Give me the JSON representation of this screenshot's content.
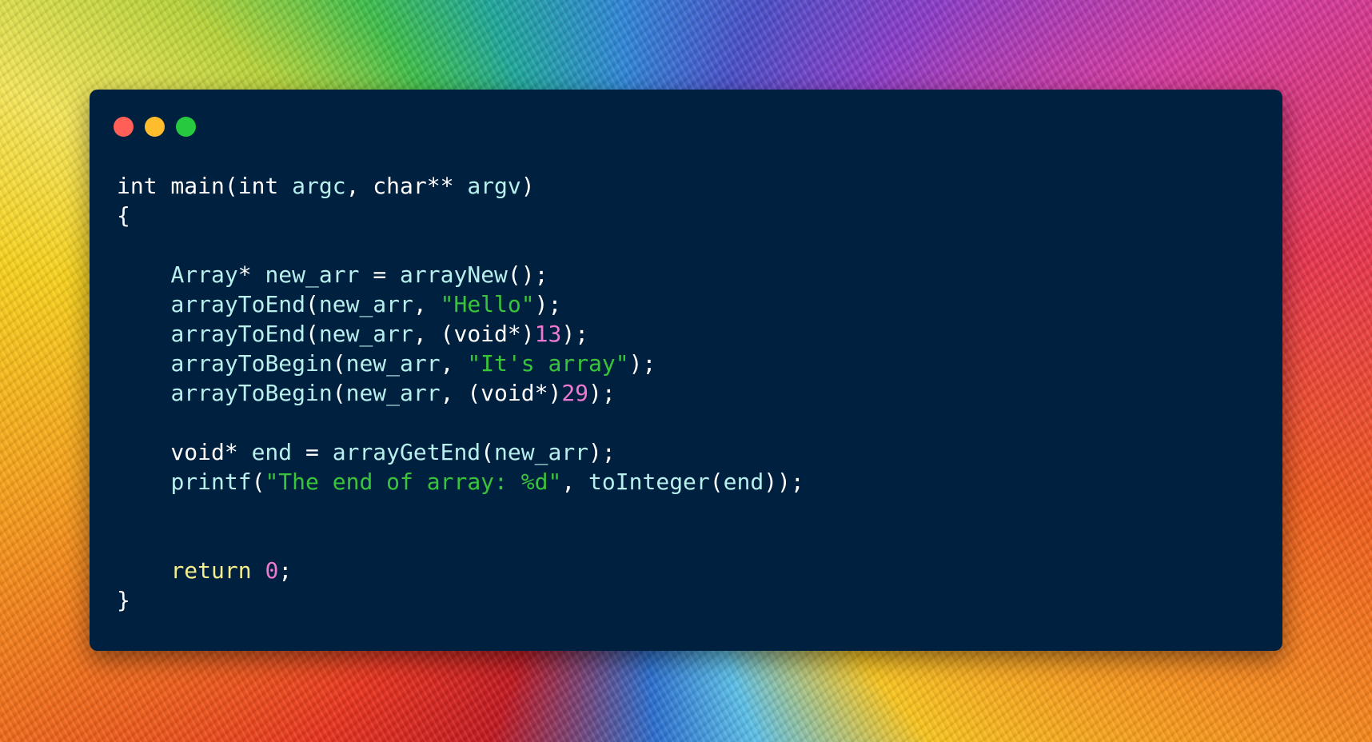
{
  "window": {
    "controls": [
      "close",
      "minimize",
      "maximize"
    ],
    "colors": {
      "background": "#00203f",
      "close": "#ff5f56",
      "minimize": "#ffbd2e",
      "maximize": "#27c93f"
    }
  },
  "code": {
    "colors": {
      "plain": "#ffffff",
      "identifier": "#b8f0ee",
      "keyword": "#f4ee8e",
      "string": "#39c53b",
      "number": "#ee79d1"
    },
    "lines": [
      [
        [
          "pl",
          "int main(int "
        ],
        [
          "fn",
          "argc"
        ],
        [
          "pl",
          ", char** "
        ],
        [
          "fn",
          "argv"
        ],
        [
          "pl",
          ")"
        ]
      ],
      [
        [
          "pl",
          "{"
        ]
      ],
      [],
      [
        [
          "pl",
          "    "
        ],
        [
          "fn",
          "Array"
        ],
        [
          "pl",
          "* "
        ],
        [
          "fn",
          "new_arr"
        ],
        [
          "pl",
          " = "
        ],
        [
          "fn",
          "arrayNew"
        ],
        [
          "pl",
          "();"
        ]
      ],
      [
        [
          "pl",
          "    "
        ],
        [
          "fn",
          "arrayToEnd"
        ],
        [
          "pl",
          "("
        ],
        [
          "fn",
          "new_arr"
        ],
        [
          "pl",
          ", "
        ],
        [
          "str",
          "\"Hello\""
        ],
        [
          "pl",
          ");"
        ]
      ],
      [
        [
          "pl",
          "    "
        ],
        [
          "fn",
          "arrayToEnd"
        ],
        [
          "pl",
          "("
        ],
        [
          "fn",
          "new_arr"
        ],
        [
          "pl",
          ", (void*)"
        ],
        [
          "num",
          "13"
        ],
        [
          "pl",
          ");"
        ]
      ],
      [
        [
          "pl",
          "    "
        ],
        [
          "fn",
          "arrayToBegin"
        ],
        [
          "pl",
          "("
        ],
        [
          "fn",
          "new_arr"
        ],
        [
          "pl",
          ", "
        ],
        [
          "str",
          "\"It's array\""
        ],
        [
          "pl",
          ");"
        ]
      ],
      [
        [
          "pl",
          "    "
        ],
        [
          "fn",
          "arrayToBegin"
        ],
        [
          "pl",
          "("
        ],
        [
          "fn",
          "new_arr"
        ],
        [
          "pl",
          ", (void*)"
        ],
        [
          "num",
          "29"
        ],
        [
          "pl",
          ");"
        ]
      ],
      [],
      [
        [
          "pl",
          "    void* "
        ],
        [
          "fn",
          "end"
        ],
        [
          "pl",
          " = "
        ],
        [
          "fn",
          "arrayGetEnd"
        ],
        [
          "pl",
          "("
        ],
        [
          "fn",
          "new_arr"
        ],
        [
          "pl",
          ");"
        ]
      ],
      [
        [
          "pl",
          "    "
        ],
        [
          "fn",
          "printf"
        ],
        [
          "pl",
          "("
        ],
        [
          "str",
          "\"The end of array: %d\""
        ],
        [
          "pl",
          ", "
        ],
        [
          "fn",
          "toInteger"
        ],
        [
          "pl",
          "("
        ],
        [
          "fn",
          "end"
        ],
        [
          "pl",
          "));"
        ]
      ],
      [],
      [],
      [
        [
          "pl",
          "    "
        ],
        [
          "kw",
          "return"
        ],
        [
          "pl",
          " "
        ],
        [
          "num",
          "0"
        ],
        [
          "pl",
          ";"
        ]
      ],
      [
        [
          "pl",
          "}"
        ]
      ]
    ]
  }
}
